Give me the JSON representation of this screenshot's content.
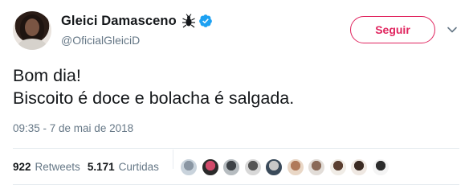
{
  "author": {
    "display_name": "Gleici Damasceno",
    "handle": "@OficialGleiciD",
    "badge_icons": [
      "bug-icon",
      "verified-icon"
    ],
    "verified_color": "#1da1f2"
  },
  "follow_button": {
    "label": "Seguir",
    "color": "#e0245e"
  },
  "tweet": {
    "text": "Bom dia!\nBiscoito é doce e bolacha é salgada.",
    "timestamp": "09:35 - 7 de mai de 2018"
  },
  "stats": {
    "retweets_count": "922",
    "retweets_label": "Retweets",
    "likes_count": "5.171",
    "likes_label": "Curtidas"
  },
  "likers": [
    {
      "name": "liker-avatar-1",
      "colors": [
        "#c9d3dc",
        "#8a96a3"
      ]
    },
    {
      "name": "liker-avatar-2",
      "colors": [
        "#2a2a2a",
        "#d14a6a"
      ]
    },
    {
      "name": "liker-avatar-3",
      "colors": [
        "#b6bcc0",
        "#3d4247"
      ]
    },
    {
      "name": "liker-avatar-4",
      "colors": [
        "#d8d8d8",
        "#555555"
      ]
    },
    {
      "name": "liker-avatar-5",
      "colors": [
        "#3a4a5a",
        "#c8c8c8"
      ]
    },
    {
      "name": "liker-avatar-6",
      "colors": [
        "#e9d7c6",
        "#b07a5a"
      ]
    },
    {
      "name": "liker-avatar-7",
      "colors": [
        "#e2ddd8",
        "#8a6a58"
      ]
    },
    {
      "name": "liker-avatar-8",
      "colors": [
        "#f0ece6",
        "#5a3e30"
      ]
    },
    {
      "name": "liker-avatar-9",
      "colors": [
        "#efe8e2",
        "#3a2a22"
      ]
    },
    {
      "name": "liker-avatar-10",
      "colors": [
        "#f4f4f4",
        "#2c2c2c"
      ]
    }
  ]
}
